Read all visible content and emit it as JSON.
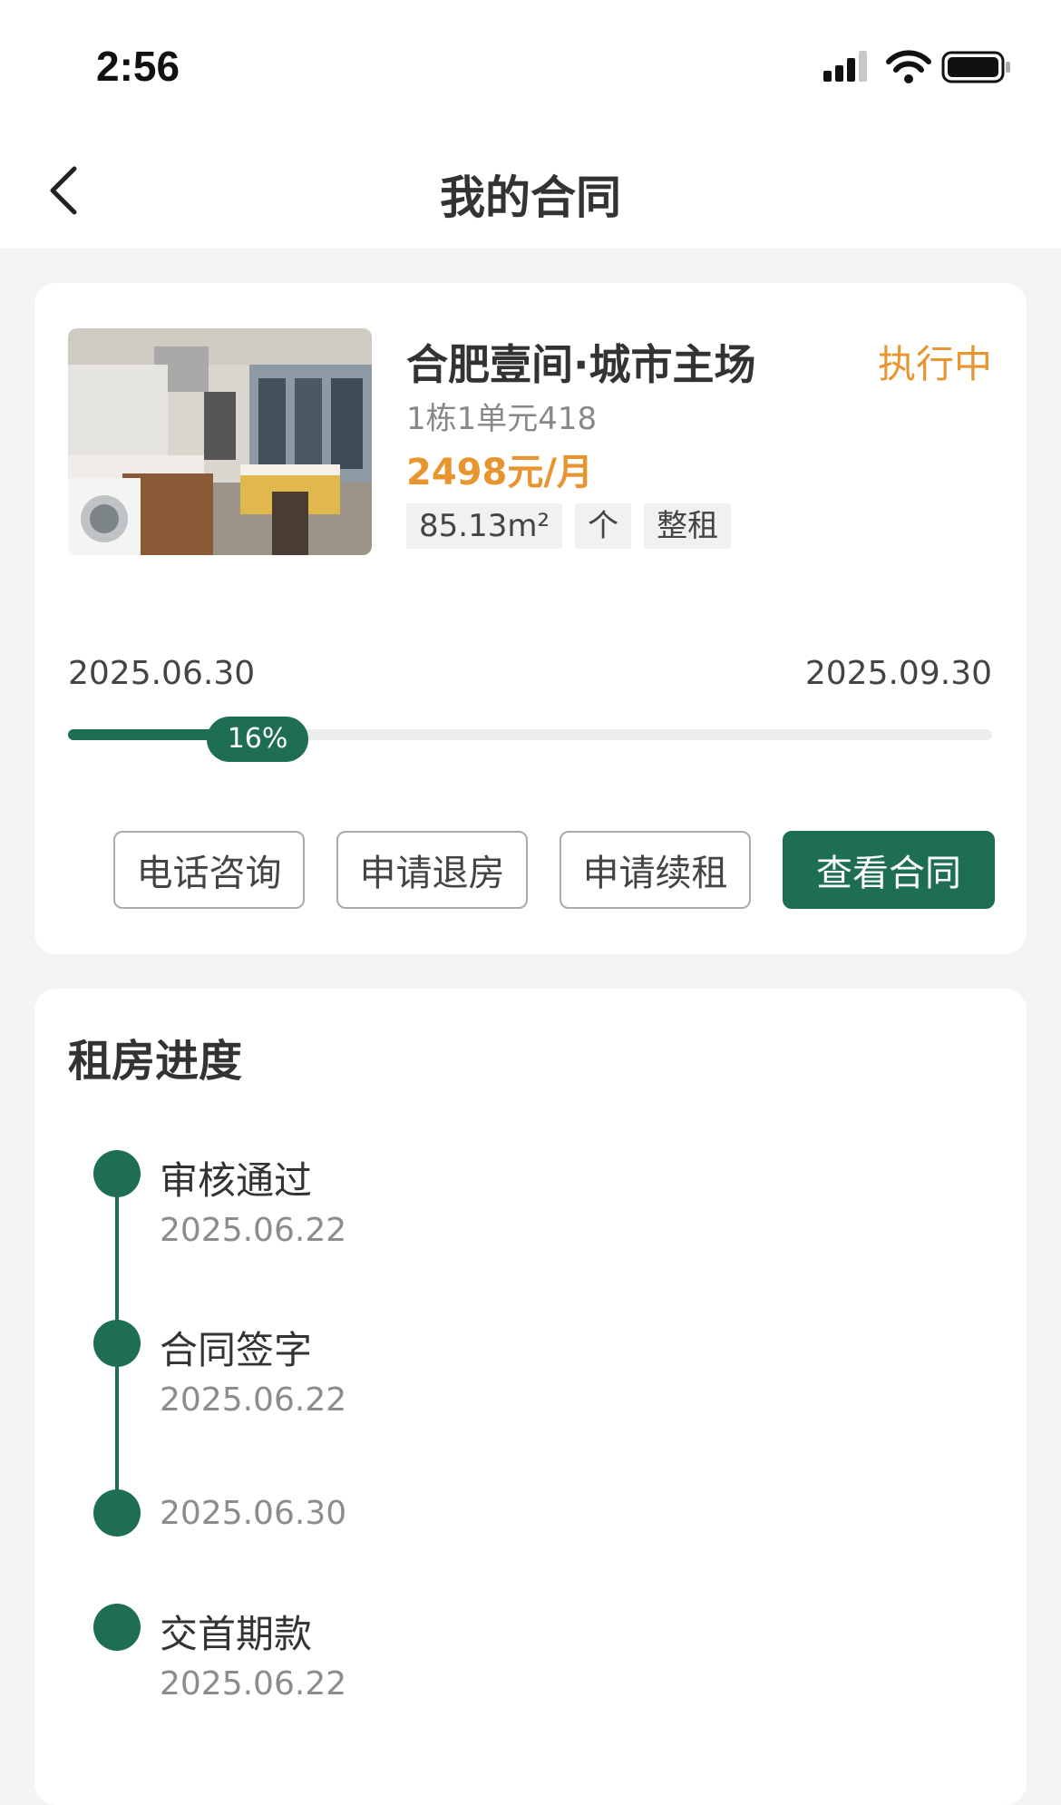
{
  "status_bar": {
    "time": "2:56"
  },
  "nav": {
    "title": "我的合同"
  },
  "contract": {
    "name": "合肥壹间·城市主场",
    "status": "执行中",
    "unit": "1栋1单元418",
    "price": "2498元/月",
    "tags": [
      "85.13m²",
      "个",
      "整租"
    ],
    "start_date": "2025.06.30",
    "end_date": "2025.09.30",
    "progress_label": "16%",
    "progress_value": 0.16,
    "buttons": {
      "phone": "电话咨询",
      "checkout": "申请退房",
      "renew": "申请续租",
      "view": "查看合同"
    }
  },
  "progress_section": {
    "title": "租房进度",
    "steps": [
      {
        "title": "审核通过",
        "date": "2025.06.22"
      },
      {
        "title": "合同签字",
        "date": "2025.06.22"
      },
      {
        "title": "",
        "date": "2025.06.30"
      },
      {
        "title": "交首期款",
        "date": "2025.06.22"
      }
    ]
  },
  "colors": {
    "brand": "#1e6f52",
    "accent": "#e8952f"
  }
}
